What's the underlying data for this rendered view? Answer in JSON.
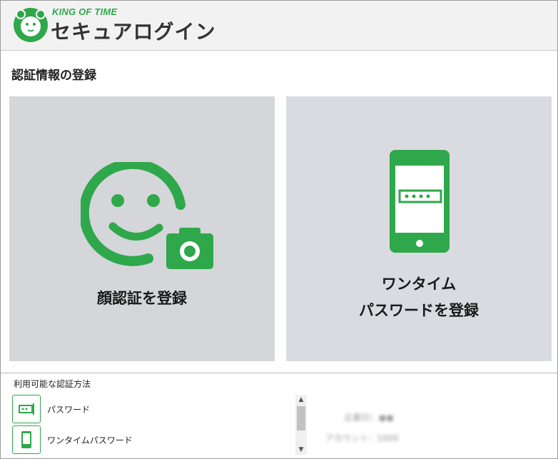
{
  "header": {
    "brand_small": "KING OF TIME",
    "brand_title": "セキュアログイン"
  },
  "section_title": "認証情報の登録",
  "tiles": [
    {
      "label": "顔認証を登録",
      "icon": "face-camera-icon"
    },
    {
      "label_line1": "ワンタイム",
      "label_line2": "パスワードを登録",
      "icon": "smartphone-password-icon"
    }
  ],
  "methods": {
    "title": "利用可能な認証方法",
    "items": [
      {
        "label": "パスワード",
        "icon": "password-icon"
      },
      {
        "label": "ワンタイムパスワード",
        "icon": "smartphone-icon"
      }
    ]
  },
  "account": {
    "company_id": "企業ID：●●",
    "account": "アカウント：1000"
  },
  "colors": {
    "accent": "#2ea84a",
    "tile_bg": "#d4d6da",
    "header_bg": "#f2f2f2"
  }
}
